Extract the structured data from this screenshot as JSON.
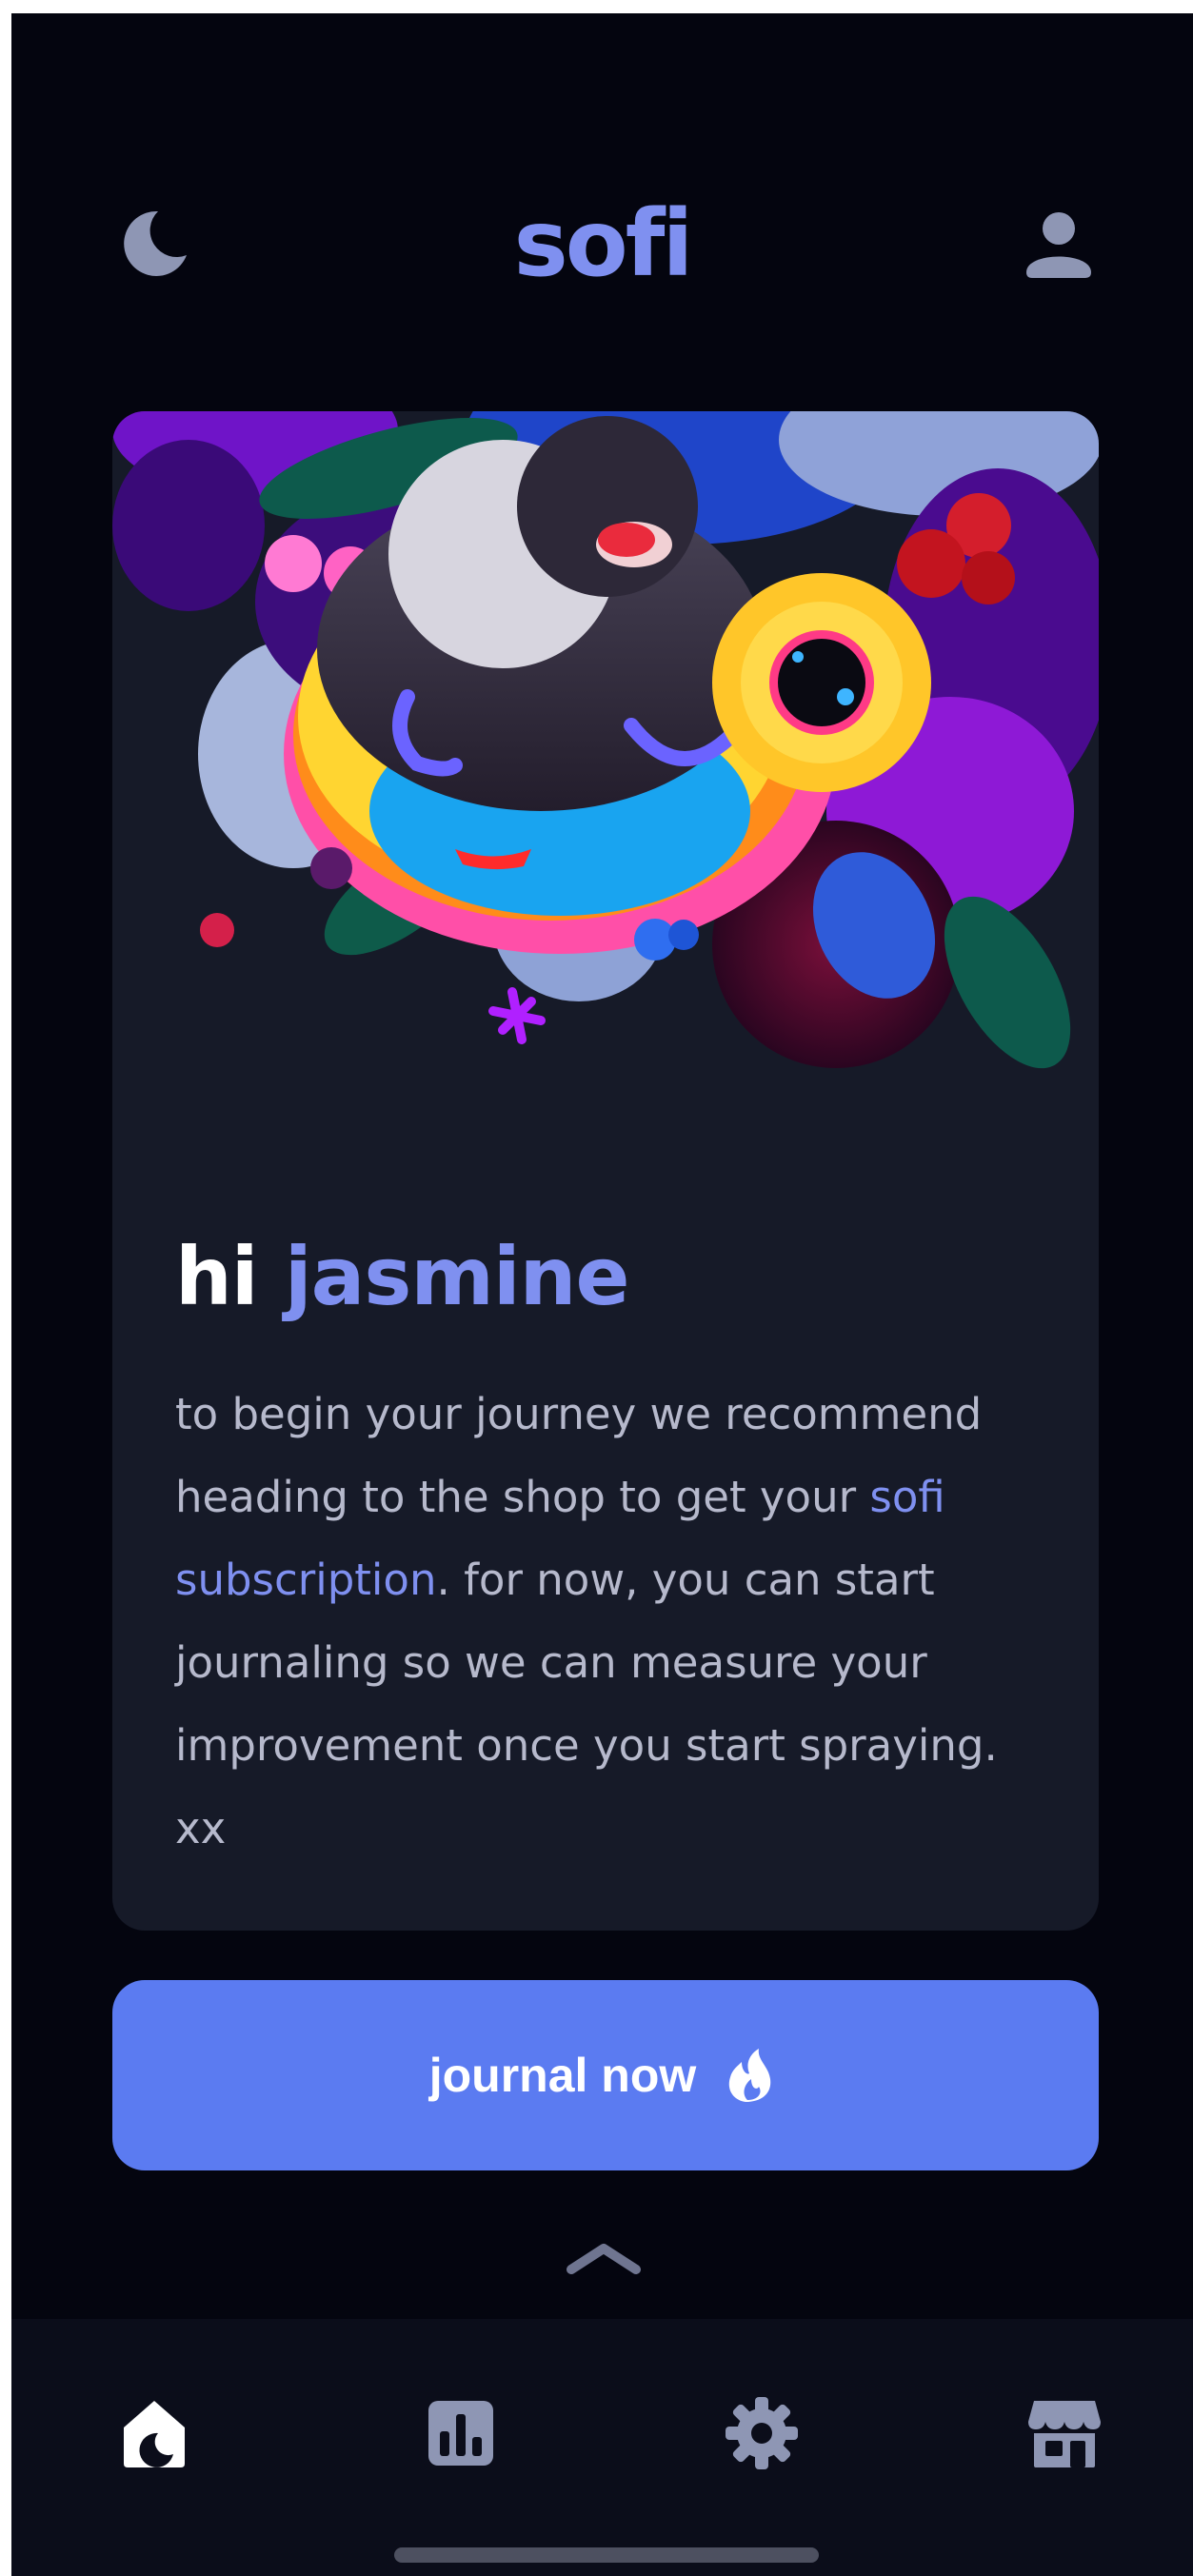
{
  "header": {
    "logo": "sofi",
    "theme_icon": "moon-icon",
    "profile_icon": "user-icon"
  },
  "card": {
    "greeting_prefix": "hi",
    "greeting_name": "jasmine",
    "body_before_link": "to begin your journey we recommend heading to the shop to get your ",
    "body_link": "sofi subscription",
    "body_after_link": ". for now, you can start journaling so we can measure your improvement once you start spraying. xx"
  },
  "cta": {
    "label": "journal now",
    "icon": "flame-icon"
  },
  "expand_icon": "chevron-up-icon",
  "bottom_nav": {
    "items": [
      {
        "icon": "home-icon",
        "active": true
      },
      {
        "icon": "chart-icon",
        "active": false
      },
      {
        "icon": "gear-icon",
        "active": false
      },
      {
        "icon": "shop-icon",
        "active": false
      }
    ]
  },
  "colors": {
    "background": "#04050f",
    "card": "#161a28",
    "accent": "#7f90f0",
    "button": "#5b7bf1",
    "text_muted": "#b6b9cc",
    "icon_inactive": "#8e96b4"
  }
}
